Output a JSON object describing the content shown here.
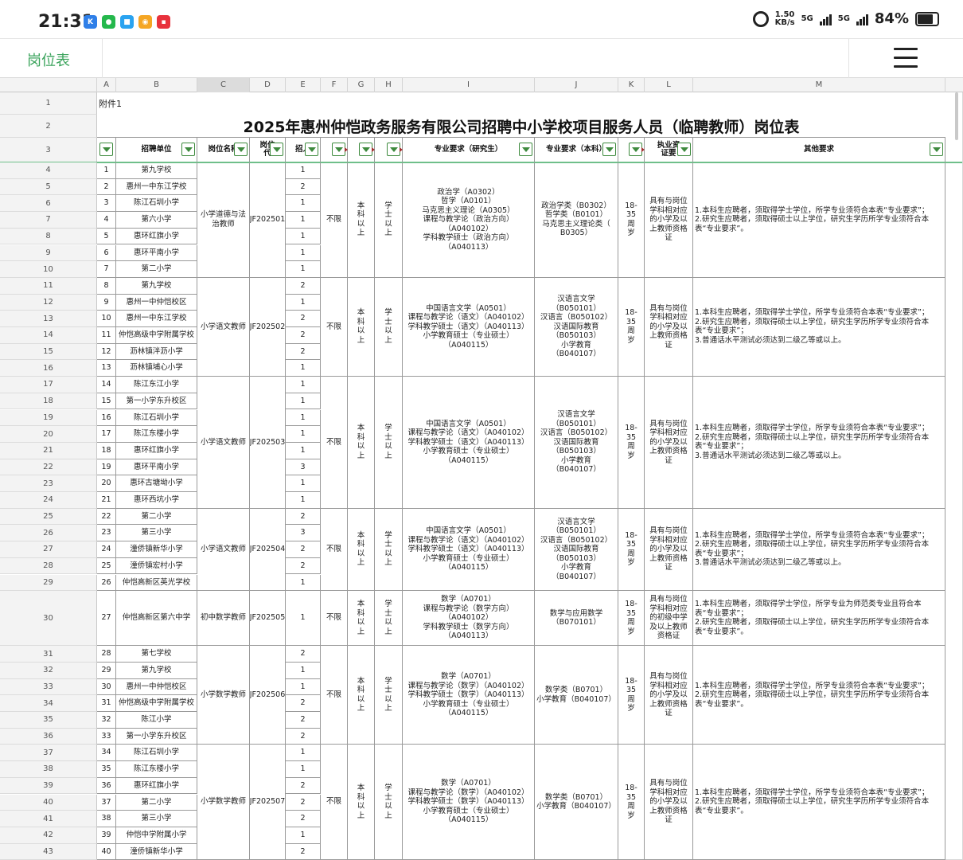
{
  "status_bar": {
    "time": "21:31",
    "speed": "1.50\nKB/s",
    "network1": "5G",
    "network2": "5G",
    "battery": "84%"
  },
  "toolbar": {
    "title": "岗位表"
  },
  "columns": [
    "A",
    "B",
    "C",
    "D",
    "E",
    "F",
    "G",
    "H",
    "I",
    "J",
    "K",
    "L",
    "M"
  ],
  "sheet": {
    "annex": "附件1",
    "title": "2025年惠州仲恺政务服务有限公司招聘中小学校项目服务人员（临聘教师）岗位表",
    "headers": {
      "unit": "招聘单位",
      "post_name": "岗位名称",
      "post_code": "岗位代",
      "hire_count": "招人",
      "major_grad": "专业要求（研究生）",
      "major_ug": "专业要求（本科）",
      "qual": "执业资证要",
      "other": "其他要求"
    },
    "rows": [
      {
        "r": "4",
        "n": "1",
        "unit": "第九学校",
        "cnt": "1"
      },
      {
        "r": "5",
        "n": "2",
        "unit": "惠州一中东江学校",
        "cnt": "2"
      },
      {
        "r": "6",
        "n": "3",
        "unit": "陈江石圳小学",
        "cnt": "1"
      },
      {
        "r": "7",
        "n": "4",
        "unit": "第六小学",
        "cnt": "1"
      },
      {
        "r": "8",
        "n": "5",
        "unit": "惠环红旗小学",
        "cnt": "1"
      },
      {
        "r": "9",
        "n": "6",
        "unit": "惠环平南小学",
        "cnt": "1"
      },
      {
        "r": "10",
        "n": "7",
        "unit": "第二小学",
        "cnt": "1"
      },
      {
        "r": "11",
        "n": "8",
        "unit": "第九学校",
        "cnt": "2"
      },
      {
        "r": "12",
        "n": "9",
        "unit": "惠州一中仲恺校区",
        "cnt": "1"
      },
      {
        "r": "13",
        "n": "10",
        "unit": "惠州一中东江学校",
        "cnt": "2"
      },
      {
        "r": "14",
        "n": "11",
        "unit": "仲恺高级中学附属学校",
        "cnt": "2"
      },
      {
        "r": "15",
        "n": "12",
        "unit": "沥林镇泮沥小学",
        "cnt": "2"
      },
      {
        "r": "16",
        "n": "13",
        "unit": "沥林镇埔心小学",
        "cnt": "1"
      },
      {
        "r": "17",
        "n": "14",
        "unit": "陈江东江小学",
        "cnt": "1"
      },
      {
        "r": "18",
        "n": "15",
        "unit": "第一小学东升校区",
        "cnt": "1"
      },
      {
        "r": "19",
        "n": "16",
        "unit": "陈江石圳小学",
        "cnt": "1"
      },
      {
        "r": "20",
        "n": "17",
        "unit": "陈江东楼小学",
        "cnt": "1"
      },
      {
        "r": "21",
        "n": "18",
        "unit": "惠环红旗小学",
        "cnt": "1"
      },
      {
        "r": "22",
        "n": "19",
        "unit": "惠环平南小学",
        "cnt": "3"
      },
      {
        "r": "23",
        "n": "20",
        "unit": "惠环古塘坳小学",
        "cnt": "1"
      },
      {
        "r": "24",
        "n": "21",
        "unit": "惠环西坑小学",
        "cnt": "1"
      },
      {
        "r": "25",
        "n": "22",
        "unit": "第二小学",
        "cnt": "2"
      },
      {
        "r": "26",
        "n": "23",
        "unit": "第三小学",
        "cnt": "3"
      },
      {
        "r": "27",
        "n": "24",
        "unit": "潼侨镇新华小学",
        "cnt": "2"
      },
      {
        "r": "28",
        "n": "25",
        "unit": "潼侨镇宏村小学",
        "cnt": "2"
      },
      {
        "r": "29",
        "n": "26",
        "unit": "仲恺高新区英光学校",
        "cnt": "1"
      },
      {
        "r": "30",
        "n": "27",
        "unit": "仲恺高新区第六中学",
        "cnt": "1"
      },
      {
        "r": "31",
        "n": "28",
        "unit": "第七学校",
        "cnt": "2"
      },
      {
        "r": "32",
        "n": "29",
        "unit": "第九学校",
        "cnt": "1"
      },
      {
        "r": "33",
        "n": "30",
        "unit": "惠州一中仲恺校区",
        "cnt": "1"
      },
      {
        "r": "34",
        "n": "31",
        "unit": "仲恺高级中学附属学校",
        "cnt": "2"
      },
      {
        "r": "35",
        "n": "32",
        "unit": "陈江小学",
        "cnt": "2"
      },
      {
        "r": "36",
        "n": "33",
        "unit": "第一小学东升校区",
        "cnt": "2"
      },
      {
        "r": "37",
        "n": "34",
        "unit": "陈江石圳小学",
        "cnt": "1"
      },
      {
        "r": "38",
        "n": "35",
        "unit": "陈江东楼小学",
        "cnt": "1"
      },
      {
        "r": "39",
        "n": "36",
        "unit": "惠环红旗小学",
        "cnt": "2"
      },
      {
        "r": "40",
        "n": "37",
        "unit": "第二小学",
        "cnt": "2"
      },
      {
        "r": "41",
        "n": "38",
        "unit": "第三小学",
        "cnt": "2"
      },
      {
        "r": "42",
        "n": "39",
        "unit": "仲恺中学附属小学",
        "cnt": "1"
      },
      {
        "r": "43",
        "n": "40",
        "unit": "潼侨镇新华小学",
        "cnt": "2"
      }
    ],
    "groups": [
      {
        "post": "小学道德与法治教师",
        "code": "JF202501",
        "age": "不限",
        "edu": "本科以上",
        "degree": "学士以上",
        "grad": "政治学（A0302）\n哲学（A0101）\n马克思主义理论（A0305）\n课程与教学论（政治方向）\n（A040102）\n学科教学硕士（政治方向）\n（A040113）",
        "ug": "政治学类（B0302）\n哲学类（B0101）\n马克思主义理论类（\nB0305）",
        "agerange": "18-35周岁",
        "qual": "具有与岗位学科相对应的小学及以上教师资格证",
        "other": "1.本科生应聘者，须取得学士学位，所学专业须符合本表“专业要求”；\n2.研究生应聘者，须取得硕士以上学位，研究生学历所学专业须符合本表“专业要求”。"
      },
      {
        "post": "小学语文教师",
        "code": "JF202502",
        "age": "不限",
        "edu": "本科以上",
        "degree": "学士以上",
        "grad": "中国语言文学（A0501）\n课程与教学论（语文）（A040102）\n学科教学硕士（语文）（A040113）\n小学教育硕士（专业硕士）\n（A040115）",
        "ug": "汉语言文学\n（B050101）\n汉语言（B050102）\n汉语国际教育\n（B050103）\n小学教育\n（B040107）",
        "agerange": "18-35周岁",
        "qual": "具有与岗位学科相对应的小学及以上教师资格证",
        "other": "1.本科生应聘者，须取得学士学位，所学专业须符合本表“专业要求”；\n2.研究生应聘者，须取得硕士以上学位，研究生学历所学专业须符合本表“专业要求”；\n3.普通话水平测试必须达到二级乙等或以上。"
      },
      {
        "post": "小学语文教师",
        "code": "JF202503",
        "age": "不限",
        "edu": "本科以上",
        "degree": "学士以上",
        "grad": "中国语言文学（A0501）\n课程与教学论（语文）（A040102）\n学科教学硕士（语文）（A040113）\n小学教育硕士（专业硕士）\n（A040115）",
        "ug": "汉语言文学\n（B050101）\n汉语言（B050102）\n汉语国际教育\n（B050103）\n小学教育\n（B040107）",
        "agerange": "18-35周岁",
        "qual": "具有与岗位学科相对应的小学及以上教师资格证",
        "other": "1.本科生应聘者，须取得学士学位，所学专业须符合本表“专业要求”；\n2.研究生应聘者，须取得硕士以上学位，研究生学历所学专业须符合本表“专业要求”；\n3.普通话水平测试必须达到二级乙等或以上。"
      },
      {
        "post": "小学语文教师",
        "code": "JF202504",
        "age": "不限",
        "edu": "本科以上",
        "degree": "学士以上",
        "grad": "中国语言文学（A0501）\n课程与教学论（语文）（A040102）\n学科教学硕士（语文）（A040113）\n小学教育硕士（专业硕士）\n（A040115）",
        "ug": "汉语言文学\n（B050101）\n汉语言（B050102）\n汉语国际教育\n（B050103）\n小学教育\n（B040107）",
        "agerange": "18-35周岁",
        "qual": "具有与岗位学科相对应的小学及以上教师资格证",
        "other": "1.本科生应聘者，须取得学士学位，所学专业须符合本表“专业要求”；\n2.研究生应聘者，须取得硕士以上学位，研究生学历所学专业须符合本表“专业要求”；\n3.普通话水平测试必须达到二级乙等或以上。"
      },
      {
        "post": "初中数学教师",
        "code": "JF202505",
        "age": "不限",
        "edu": "本科以上",
        "degree": "学士以上",
        "grad": "数学（A0701）\n课程与教学论（数学方向）\n（A040102）\n学科教学硕士（数学方向）\n（A040113）",
        "ug": "数学与应用数学\n（B070101）",
        "agerange": "18-35周岁",
        "qual": "具有与岗位学科相对应的初级中学及以上教师资格证",
        "other": "1.本科生应聘者，须取得学士学位，所学专业为师范类专业且符合本表“专业要求”；\n2.研究生应聘者，须取得硕士以上学位，研究生学历所学专业须符合本表“专业要求”。"
      },
      {
        "post": "小学数学教师",
        "code": "JF202506",
        "age": "不限",
        "edu": "本科以上",
        "degree": "学士以上",
        "grad": "数学（A0701）\n课程与教学论（数学）（A040102）\n学科教学硕士（数学）（A040113）\n小学教育硕士（专业硕士）\n（A040115）",
        "ug": "数学类（B0701）\n小学教育（B040107）",
        "agerange": "18-35周岁",
        "qual": "具有与岗位学科相对应的小学及以上教师资格证",
        "other": "1.本科生应聘者，须取得学士学位，所学专业须符合本表“专业要求”；\n2.研究生应聘者，须取得硕士以上学位，研究生学历所学专业须符合本表“专业要求”。"
      },
      {
        "post": "小学数学教师",
        "code": "JF202507",
        "age": "不限",
        "edu": "本科以上",
        "degree": "学士以上",
        "grad": "数学（A0701）\n课程与教学论（数学）（A040102）\n学科教学硕士（数学）（A040113）\n小学教育硕士（专业硕士）\n（A040115）",
        "ug": "数学类（B0701）\n小学教育（B040107）",
        "agerange": "18-35周岁",
        "qual": "具有与岗位学科相对应的小学及以上教师资格证",
        "other": "1.本科生应聘者，须取得学士学位，所学专业须符合本表“专业要求”；\n2.研究生应聘者，须取得硕士以上学位，研究生学历所学专业须符合本表“专业要求”。"
      }
    ]
  }
}
